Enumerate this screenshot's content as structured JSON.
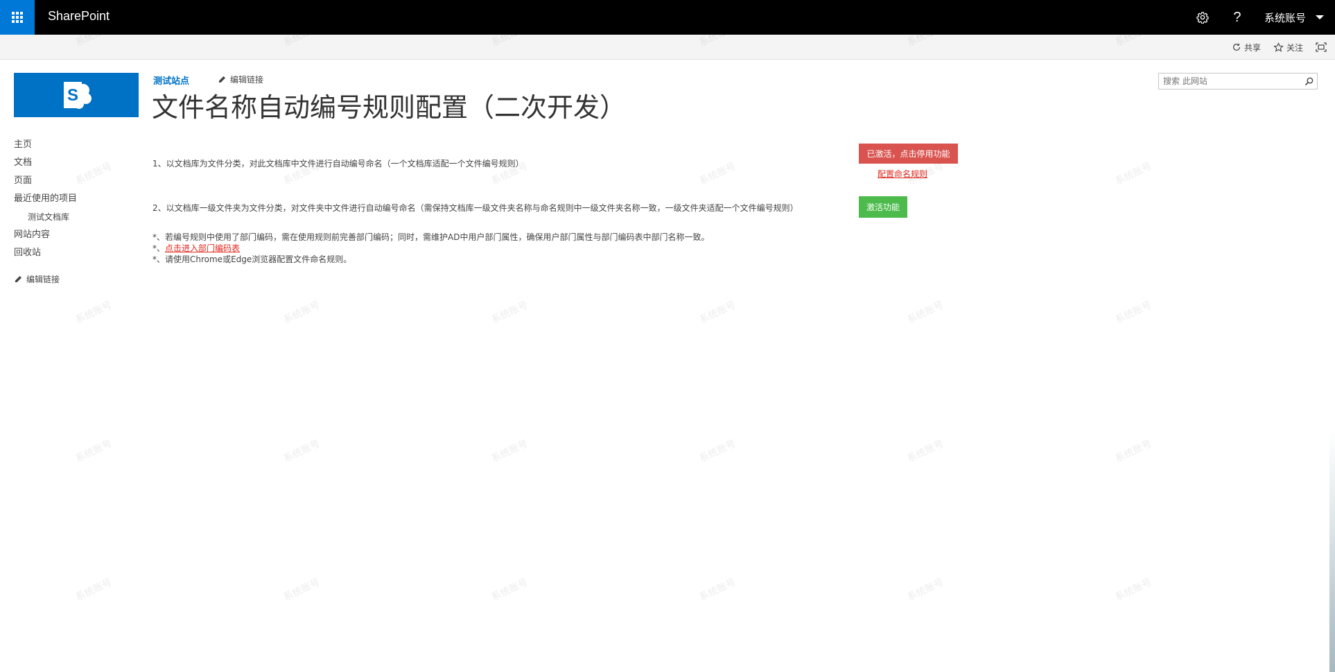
{
  "suite_bar": {
    "brand": "SharePoint",
    "help": "?",
    "user_name": "系统账号",
    "icons": [
      "app-launcher-icon",
      "gear-icon",
      "help-icon",
      "chevron-down-icon"
    ],
    "accent_color": "#0078d7"
  },
  "ribbon": {
    "share_label": "共享",
    "follow_label": "关注"
  },
  "site_header": {
    "site_title": "测试站点",
    "edit_links_label": "编辑链接",
    "page_title": "文件名称自动编号规则配置（二次开发）",
    "search_placeholder": "搜索 此网站"
  },
  "left_nav": {
    "items": [
      "主页",
      "文档",
      "页面",
      "最近使用的项目"
    ],
    "sub_items": [
      "测试文档库"
    ],
    "items_after": [
      "网站内容",
      "回收站"
    ],
    "edit_links_label": "编辑链接"
  },
  "main": {
    "rule1_text": "1、以文档库为文件分类，对此文档库中文件进行自动编号命名（一个文档库适配一个文件编号规则）",
    "rule1_button": "已激活，点击停用功能",
    "rule1_config_link": "配置命名规则",
    "rule2_text": "2、以文档库一级文件夹为文件分类，对文件夹中文件进行自动编号命名（需保持文档库一级文件夹名称与命名规则中一级文件夹名称一致，一级文件夹适配一个文件编号规则）",
    "rule2_button": "激活功能",
    "note1": "*、若编号规则中使用了部门编码，需在使用规则前完善部门编码；同时，需维护AD中用户部门属性，确保用户部门属性与部门编码表中部门名称一致。",
    "note2_prefix": "*、",
    "note2_link": "点击进入部门编码表",
    "note3": "*、请使用Chrome或Edge浏览器配置文件命名规则。",
    "colors": {
      "deactivate": "#d9534f",
      "activate": "#4cbb4c",
      "link": "#e0281e"
    }
  },
  "watermark_text": "系统账号"
}
